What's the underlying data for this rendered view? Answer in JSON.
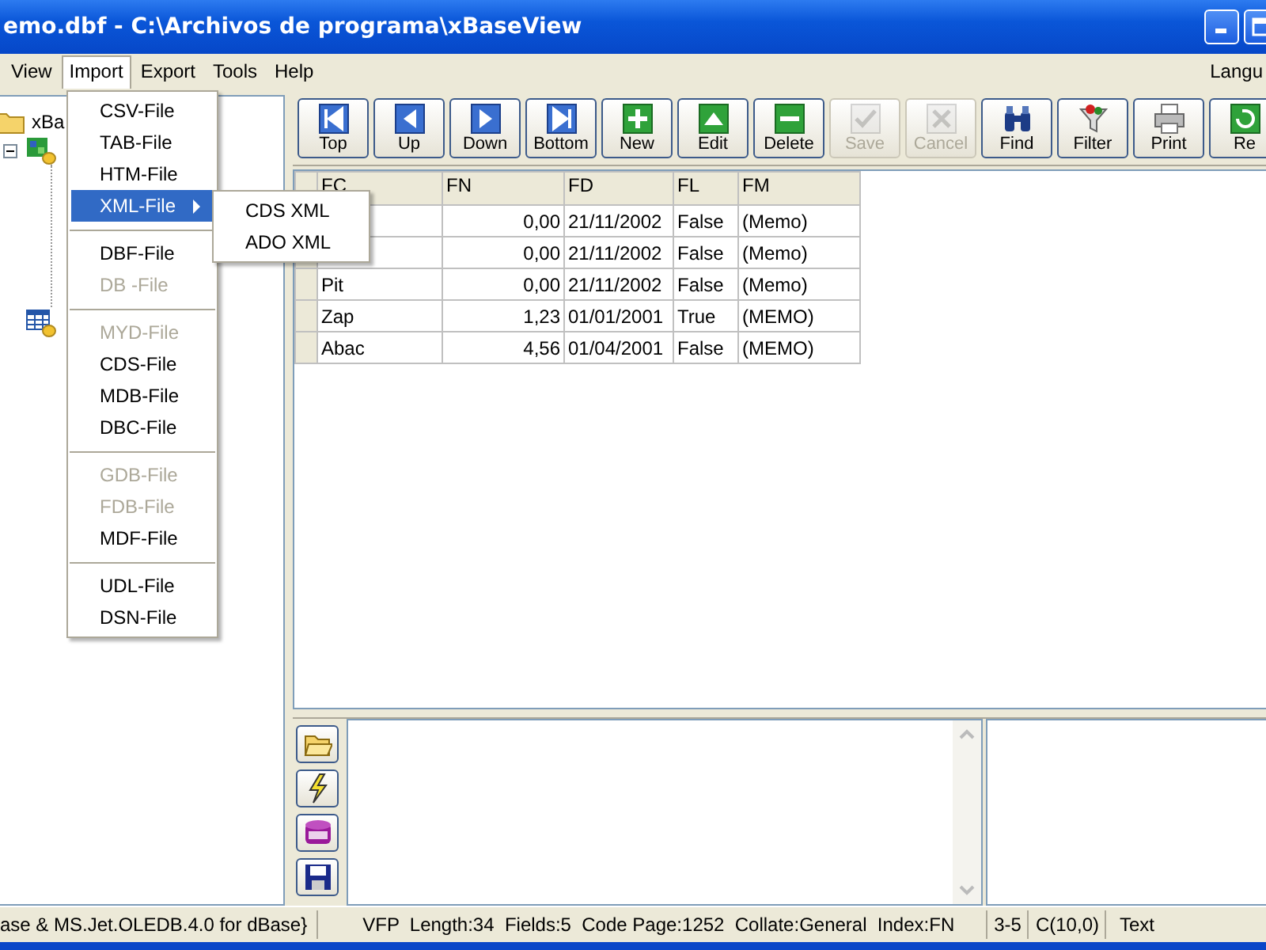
{
  "window": {
    "title": "emo.dbf - C:\\Archivos de programa\\xBaseView"
  },
  "menu_bar": {
    "items": [
      {
        "label": "View",
        "selected": false
      },
      {
        "label": "Import",
        "selected": true
      },
      {
        "label": "Export",
        "selected": false
      },
      {
        "label": "Tools",
        "selected": false
      },
      {
        "label": "Help",
        "selected": false
      }
    ],
    "right_label": "Langu"
  },
  "tree": {
    "root_label": "xBa",
    "nodes": [
      {
        "kind": "database",
        "expanded": true
      },
      {
        "kind": "table"
      }
    ]
  },
  "import_menu": {
    "items": [
      {
        "kind": "item",
        "label": "CSV-File",
        "disabled": false,
        "selected": false
      },
      {
        "kind": "item",
        "label": "TAB-File",
        "disabled": false,
        "selected": false
      },
      {
        "kind": "item",
        "label": "HTM-File",
        "disabled": false,
        "selected": false
      },
      {
        "kind": "submenu",
        "label": "XML-File",
        "disabled": false,
        "selected": true
      },
      {
        "kind": "separator"
      },
      {
        "kind": "item",
        "label": "DBF-File",
        "disabled": false,
        "selected": false
      },
      {
        "kind": "item",
        "label": "DB -File",
        "disabled": true,
        "selected": false
      },
      {
        "kind": "separator"
      },
      {
        "kind": "item",
        "label": "MYD-File",
        "disabled": true,
        "selected": false
      },
      {
        "kind": "item",
        "label": "CDS-File",
        "disabled": false,
        "selected": false
      },
      {
        "kind": "item",
        "label": "MDB-File",
        "disabled": false,
        "selected": false
      },
      {
        "kind": "item",
        "label": "DBC-File",
        "disabled": false,
        "selected": false
      },
      {
        "kind": "separator"
      },
      {
        "kind": "item",
        "label": "GDB-File",
        "disabled": true,
        "selected": false
      },
      {
        "kind": "item",
        "label": "FDB-File",
        "disabled": true,
        "selected": false
      },
      {
        "kind": "item",
        "label": "MDF-File",
        "disabled": false,
        "selected": false
      },
      {
        "kind": "separator"
      },
      {
        "kind": "item",
        "label": "UDL-File",
        "disabled": false,
        "selected": false
      },
      {
        "kind": "item",
        "label": "DSN-File",
        "disabled": false,
        "selected": false
      }
    ],
    "submenu": [
      "CDS XML",
      "ADO XML"
    ]
  },
  "toolbar": [
    {
      "label": "Top",
      "disabled": false
    },
    {
      "label": "Up",
      "disabled": false
    },
    {
      "label": "Down",
      "disabled": false
    },
    {
      "label": "Bottom",
      "disabled": false
    },
    {
      "label": "New",
      "disabled": false
    },
    {
      "label": "Edit",
      "disabled": false
    },
    {
      "label": "Delete",
      "disabled": false
    },
    {
      "label": "Save",
      "disabled": true
    },
    {
      "label": "Cancel",
      "disabled": true
    },
    {
      "label": "Find",
      "disabled": false
    },
    {
      "label": "Filter",
      "disabled": false
    },
    {
      "label": "Print",
      "disabled": false
    },
    {
      "label": "Re",
      "disabled": false
    }
  ],
  "table": {
    "columns": [
      "FC",
      "FN",
      "FD",
      "FL",
      "FM"
    ],
    "rows": [
      {
        "fn": "0,00",
        "fd": "21/11/2002",
        "fl": "False",
        "fm": "(Memo)"
      },
      {
        "fn": "0,00",
        "fd": "21/11/2002",
        "fl": "False",
        "fm": "(Memo)"
      },
      {
        "fc": "Pit",
        "fn": "0,00",
        "fd": "21/11/2002",
        "fl": "False",
        "fm": "(Memo)"
      },
      {
        "fc": "Zap",
        "fn": "1,23",
        "fd": "01/01/2001",
        "fl": "True",
        "fm": "(MEMO)"
      },
      {
        "fc": "Abac",
        "fn": "4,56",
        "fd": "01/04/2001",
        "fl": "False",
        "fm": "(MEMO)"
      }
    ]
  },
  "status_bar": [
    "ase & MS.Jet.OLEDB.4.0 for dBase}",
    "VFP  Length:34  Fields:5  Code Page:1252  Collate:General  Index:FN",
    "3-5",
    "C(10,0)",
    "Text"
  ]
}
